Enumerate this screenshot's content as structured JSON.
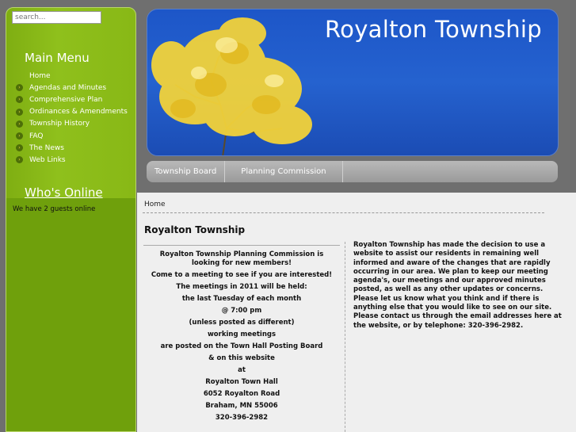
{
  "search": {
    "placeholder": "search..."
  },
  "sidebar": {
    "menu_title": "Main Menu",
    "items": [
      {
        "label": "Home"
      },
      {
        "label": "Agendas and Minutes"
      },
      {
        "label": "Comprehensive Plan"
      },
      {
        "label": "Ordinances & Amendments"
      },
      {
        "label": "Township History"
      },
      {
        "label": "FAQ"
      },
      {
        "label": "The News"
      },
      {
        "label": "Web Links"
      }
    ],
    "whos_online_title": "Who's Online",
    "whos_online_text": "We have 2 guests online"
  },
  "header": {
    "title": "Royalton Township"
  },
  "nav": {
    "tabs": [
      {
        "label": "Township Board"
      },
      {
        "label": "Planning Commission"
      }
    ]
  },
  "content": {
    "breadcrumb": "Home",
    "title": "Royalton Township",
    "left_lines": [
      "Royalton Township Planning Commission is looking for new members!",
      "Come to a meeting to see if you are interested!",
      "The meetings in 2011 will be held:",
      "the last Tuesday of each month",
      "@ 7:00 pm",
      "(unless posted as different)",
      "working meetings",
      "are posted on the Town Hall Posting Board",
      "& on this website",
      "at",
      "Royalton Town Hall",
      "6052 Royalton Road",
      "Braham, MN 55006",
      "320-396-2982"
    ],
    "right_text": "Royalton Township has made the decision to use a website to assist our residents in remaining well informed and aware of the changes that are rapidly occurring in our area. We plan to keep our meeting agenda's, our meetings and our approved minutes posted, as well as any other updates or concerns. Please let us know what you think and if there is anything else that you would like to see on our site. Please contact us through the email addresses here at the website, or by telephone: 320-396-2982."
  },
  "colors": {
    "sidebar_green": "#8fc01c",
    "header_blue": "#1d56c8",
    "tree_yellow": "#f2d23a"
  },
  "icons": {
    "menu_bullet": "chevron-right-icon",
    "header_image": "yellow-tree-image"
  }
}
